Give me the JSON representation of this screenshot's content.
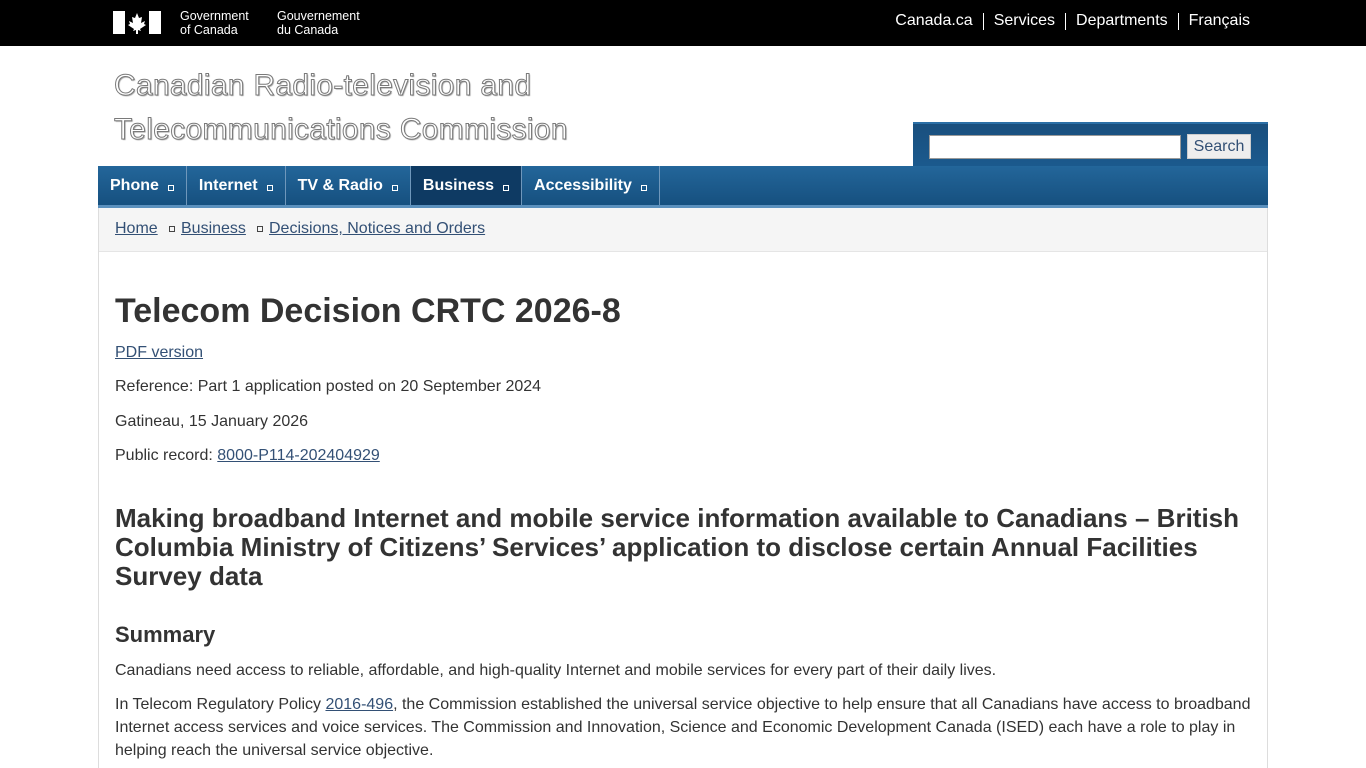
{
  "gc_bar": {
    "sig_en": [
      "Government",
      "of Canada"
    ],
    "sig_fr": [
      "Gouvernement",
      "du Canada"
    ],
    "nav": [
      "Canada.ca",
      "Services",
      "Departments",
      "Français"
    ]
  },
  "site_title": [
    "Canadian Radio-television and",
    "Telecommunications Commission"
  ],
  "search": {
    "placeholder": "",
    "button": "Search"
  },
  "menu": [
    {
      "label": "Phone",
      "active": false
    },
    {
      "label": "Internet",
      "active": false
    },
    {
      "label": "TV & Radio",
      "active": false
    },
    {
      "label": "Business",
      "active": true
    },
    {
      "label": "Accessibility",
      "active": false
    }
  ],
  "breadcrumb": [
    "Home",
    "Business",
    "Decisions, Notices and Orders"
  ],
  "page": {
    "title": "Telecom Decision CRTC 2026-8",
    "pdf_link": "PDF version",
    "reference": "Reference: Part 1 application posted on 20 September 2024",
    "dateline": "Gatineau, 15 January 2026",
    "public_record_label": "Public record: ",
    "public_record_link": "8000-P114-202404929",
    "subtitle": "Making broadband Internet and mobile service information available to Canadians – British Columbia Ministry of Citizens’ Services’ application to disclose certain Annual Facilities Survey data",
    "summary_heading": "Summary",
    "summary_p1": "Canadians need access to reliable, affordable, and high-quality Internet and mobile services for every part of their daily lives.",
    "summary_p2_before": "In Telecom Regulatory Policy ",
    "summary_p2_link": "2016-496",
    "summary_p2_after": ", the Commission established the universal service objective to help ensure that all Canadians have access to broadband Internet access services and voice services. The Commission and Innovation, Science and Economic Development Canada (ISED) each have a role to play in helping reach the universal service objective."
  },
  "colors": {
    "link": "#335075",
    "menu": "#1b5a8e",
    "menu_active": "#0e3a63",
    "gc_bar": "#000000"
  }
}
